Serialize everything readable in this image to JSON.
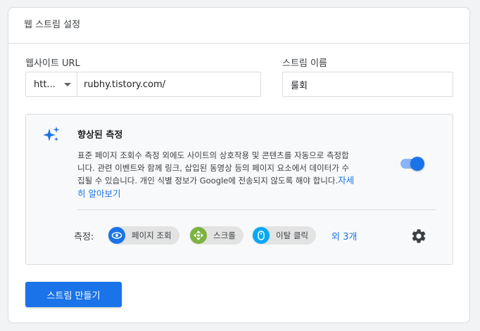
{
  "card": {
    "title": "웹 스트림 설정"
  },
  "url_field": {
    "label": "웹사이트 URL",
    "protocol": "htt...",
    "value": "rubhy.tistory.com/"
  },
  "name_field": {
    "label": "스트림 이름",
    "value": "룰회"
  },
  "enhanced": {
    "icon": "sparkle-icon",
    "title": "향상된 측정",
    "description": "표준 페이지 조회수 측정 외에도 사이트의 상호작용 및 콘텐츠를 자동으로 측정합니다. 관련 이벤트와 함께 링크, 삽입된 동영상 등의 페이지 요소에서 데이터가 수집될 수 있습니다. 개인 식별 정보가 Google에 전송되지 않도록 해야 합니다.",
    "learn_more": "자세히 알아보기",
    "toggle_on": true,
    "measure_label": "측정:",
    "chips": [
      {
        "label": "페이지 조회",
        "icon": "eye-icon",
        "color": "#1a73e8"
      },
      {
        "label": "스크롤",
        "icon": "crosshair-icon",
        "color": "#7cb342"
      },
      {
        "label": "이탈 클릭",
        "icon": "mouse-icon",
        "color": "#03a9f4"
      }
    ],
    "more": "외 3개",
    "settings_icon": "gear-icon"
  },
  "actions": {
    "create_label": "스트림 만들기"
  },
  "colors": {
    "primary": "#1a73e8",
    "toggle_track": "#8ab4f8",
    "border": "#dadce0",
    "page_bg": "#f1f3f4"
  }
}
